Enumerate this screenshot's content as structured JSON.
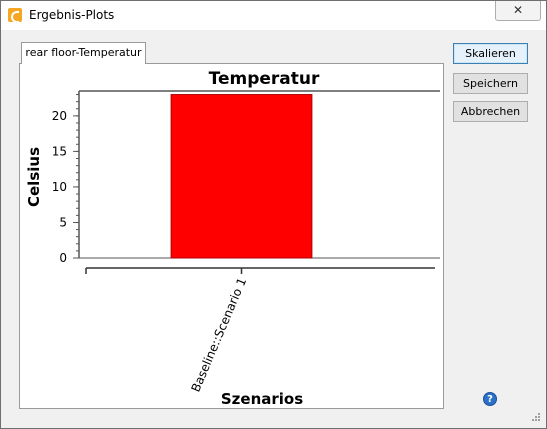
{
  "window": {
    "title": "Ergebnis-Plots",
    "close_glyph": "✕"
  },
  "tabs": [
    {
      "label": "rear floor-Temperatur"
    }
  ],
  "buttons": {
    "scale": "Skalieren",
    "save": "Speichern",
    "cancel": "Abbrechen"
  },
  "help": {
    "glyph": "?"
  },
  "colors": {
    "bar": "#ff0000",
    "bar_border": "#b00000",
    "primary_button_border": "#3c7fb1"
  },
  "chart_data": {
    "type": "bar",
    "title": "Temperatur",
    "xlabel": "Szenarios",
    "ylabel": "Celsius",
    "categories": [
      "Baseline::Scenario 1"
    ],
    "values": [
      23
    ],
    "ylim": [
      0,
      23.5
    ],
    "yticks": [
      0,
      5,
      10,
      15,
      20
    ],
    "grid": false,
    "legend": "none"
  }
}
